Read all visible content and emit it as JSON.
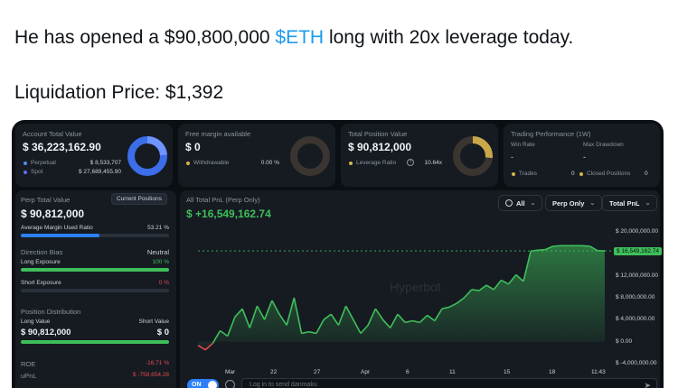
{
  "tweet": {
    "line1_pre": "He has opened a $90,800,000 ",
    "line1_link": "$ETH",
    "line1_post": " long with 20x leverage today.",
    "line2": "Liquidation Price: $1,392"
  },
  "dashboard": {
    "account": {
      "title": "Account Total Value",
      "value": "$ 36,223,162.90",
      "perpetual_label": "Perpetual",
      "perpetual_value": "$ 8,533,707",
      "spot_label": "Spot",
      "spot_value": "$ 27,689,455.90",
      "perpetual_color": "#4f8cff",
      "spot_color": "#5b6cff"
    },
    "free_margin": {
      "title": "Free margin available",
      "value": "$ 0",
      "withdrawable_label": "Withdrawable",
      "withdrawable_value": "0.00 %"
    },
    "position": {
      "title": "Total Position Value",
      "value": "$ 90,812,000",
      "leverage_label": "Leverage Ratio",
      "leverage_value": "10.64x",
      "gauge_color": "#c9a84a"
    },
    "performance": {
      "title": "Trading Performance (1W)",
      "win_rate_label": "Win Rate",
      "win_rate_value": "-",
      "max_drawdown_label": "Max Drawdown",
      "max_drawdown_value": "-",
      "trades_label": "Trades",
      "trades_value": "0",
      "closed_label": "Closed Positions",
      "closed_value": "0"
    },
    "perp": {
      "title": "Perp Total Value",
      "current_positions_btn": "Current Positions",
      "value": "$ 90,812,000",
      "margin_label": "Average Margin Used Ratio",
      "margin_value": "53.21 %",
      "margin_fraction": 0.5321,
      "direction_label": "Direction Bias",
      "direction_value": "Neutral",
      "long_exposure_label": "Long Exposure",
      "long_exposure_value": "100 %",
      "long_exposure_fraction": 1.0,
      "short_exposure_label": "Short Exposure",
      "short_exposure_value": "0 %",
      "distribution_label": "Position Distribution",
      "long_value_label": "Long Value",
      "long_value": "$ 90,812,000",
      "short_value_label": "Short Value",
      "short_value": "$ 0",
      "roe_label": "ROE",
      "roe_value": "-16.71 %",
      "upnl_label": "uPnL",
      "upnl_value": "$ -758,654.28",
      "green": "#3fbf5a",
      "red": "#e5484d",
      "blue": "#2d7ff9"
    },
    "pnl": {
      "title": "All Total PnL (Perp Only)",
      "value": "$ +16,549,162.74",
      "filter_all": "All",
      "filter_perp": "Perp Only",
      "filter_total": "Total PnL",
      "watermark": "Hyperbot",
      "danmaku_toggle": "ON",
      "danmaku_placeholder": "Log in to send danmaku"
    }
  },
  "chart_data": {
    "type": "area",
    "title": "All Total PnL (Perp Only)",
    "y_ticks": [
      "$ 20,000,000.00",
      "$ 16,549,162.74",
      "$ 12,000,000.00",
      "$ 8,000,000.00",
      "$ 4,000,000.00",
      "$ 0.00",
      "$ -4,000,000.00"
    ],
    "y_tick_values": [
      20000000,
      16549162.74,
      12000000,
      8000000,
      4000000,
      0,
      -4000000
    ],
    "current_value": 16549162.74,
    "x_tick_labels": [
      "Mar",
      "22",
      "27",
      "Apr",
      "6",
      "11",
      "15",
      "18",
      "11:43"
    ],
    "ylim": [
      -5000000,
      21000000
    ],
    "positive_color": "#3fbf5a",
    "negative_color": "#e5484d",
    "series_values": [
      -700000,
      -1500000,
      -300000,
      2000000,
      1000000,
      4500000,
      6000000,
      2500000,
      6500000,
      4000000,
      7500000,
      5000000,
      3000000,
      8000000,
      1500000,
      1800000,
      1500000,
      4000000,
      5000000,
      3000000,
      6500000,
      4000000,
      1500000,
      3000000,
      6000000,
      4000000,
      2500000,
      5000000,
      3500000,
      3800000,
      3500000,
      4800000,
      3800000,
      6000000,
      6300000,
      7000000,
      8000000,
      9500000,
      9300000,
      10300000,
      9500000,
      11200000,
      10500000,
      12200000,
      11000000,
      16500000,
      16700000,
      16800000,
      17400000,
      17500000,
      17500000,
      17500000,
      17500000,
      17400000,
      16600000,
      16549162.74
    ]
  }
}
